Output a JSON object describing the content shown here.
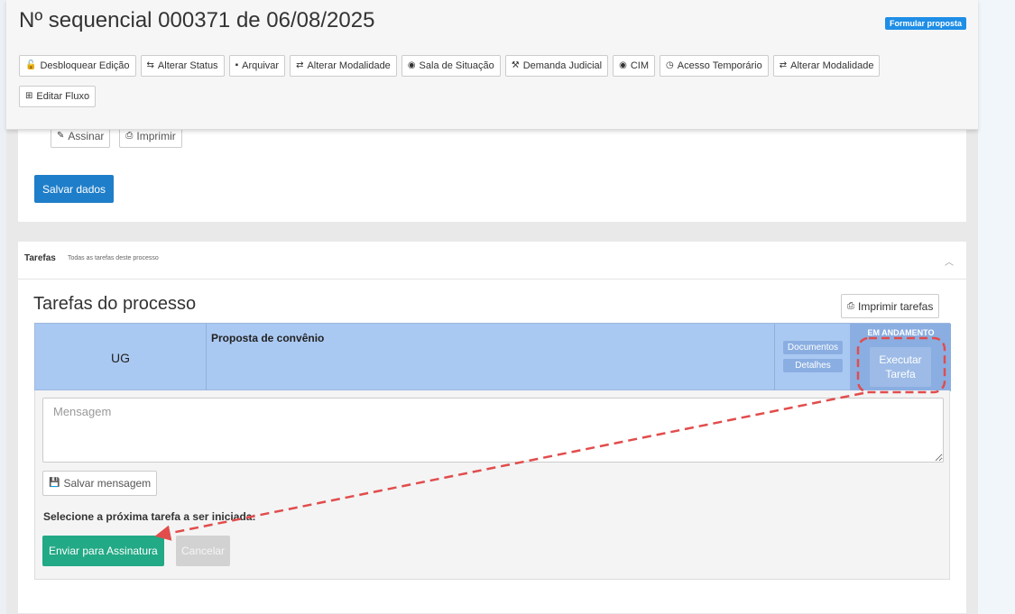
{
  "header": {
    "title": "Nº sequencial 000371 de 06/08/2025",
    "badge": "Formular proposta",
    "toolbar": [
      {
        "label": "Desbloquear Edição",
        "icon": "unlock-icon",
        "glyph": "🔓"
      },
      {
        "label": "Alterar Status",
        "icon": "retweet-icon",
        "glyph": "⇆"
      },
      {
        "label": "Arquivar",
        "icon": "archive-icon",
        "glyph": "▪"
      },
      {
        "label": "Alterar Modalidade",
        "icon": "exchange-icon",
        "glyph": "⇄"
      },
      {
        "label": "Sala de Situação",
        "icon": "eye-icon",
        "glyph": "◉"
      },
      {
        "label": "Demanda Judicial",
        "icon": "gavel-icon",
        "glyph": "⚒"
      },
      {
        "label": "CIM",
        "icon": "eye-icon",
        "glyph": "◉"
      },
      {
        "label": "Acesso Temporário",
        "icon": "clock-icon",
        "glyph": "◷"
      },
      {
        "label": "Alterar Modalidade",
        "icon": "exchange-icon",
        "glyph": "⇄"
      },
      {
        "label": "Editar Fluxo",
        "icon": "sitemap-icon",
        "glyph": "⊞"
      }
    ]
  },
  "top_card": {
    "sign_label": "Assinar",
    "print_label": "Imprimir",
    "save_label": "Salvar dados"
  },
  "tasks": {
    "header_title": "Tarefas",
    "header_subtitle": "Todas as tarefas deste processo",
    "title": "Tarefas do processo",
    "print_label": "Imprimir tarefas",
    "row": {
      "ug": "UG",
      "name": "Proposta de convênio",
      "documents_label": "Documentos",
      "details_label": "Detalhes",
      "status": "EM ANDAMENTO",
      "execute_line1": "Executar",
      "execute_line2": "Tarefa"
    },
    "message_placeholder": "Mensagem",
    "save_message_label": "Salvar mensagem",
    "next_task_label": "Selecione a próxima tarefa a ser iniciada:",
    "send_label": "Enviar para Assinatura",
    "cancel_label": "Cancelar"
  },
  "colors": {
    "primary": "#1f7ec9",
    "success": "#22a985",
    "task_row": "#aac9f2",
    "annotation": "#e24c4c"
  }
}
